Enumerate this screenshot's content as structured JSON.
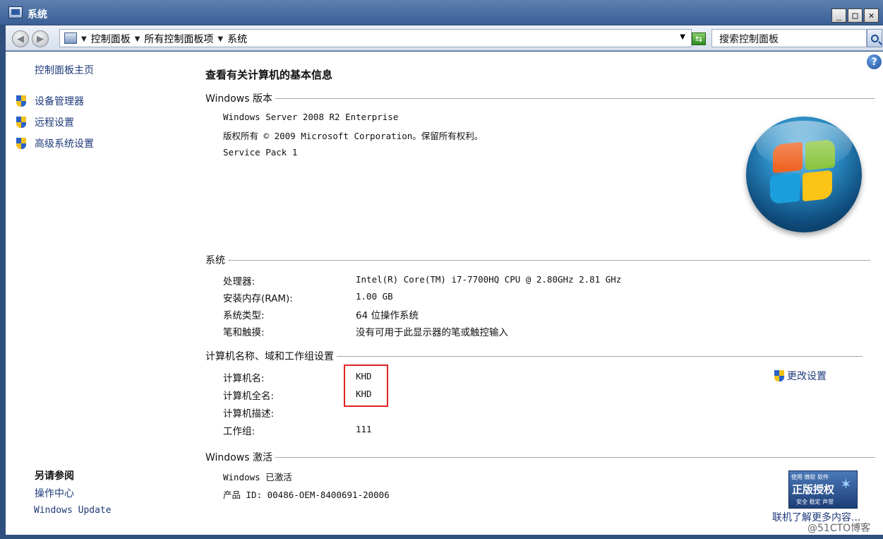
{
  "window": {
    "title": "系统",
    "minimize_glyph": "_",
    "maximize_glyph": "□",
    "close_glyph": "✕"
  },
  "address": {
    "breadcrumbs": [
      "控制面板",
      "所有控制面板项",
      "系统"
    ],
    "search_text": "搜索控制面板"
  },
  "sidebar": {
    "home_link": "控制面板主页",
    "tasks": [
      {
        "label": "设备管理器",
        "icon": "uac-shield-icon"
      },
      {
        "label": "远程设置",
        "icon": "uac-shield-icon"
      },
      {
        "label": "高级系统设置",
        "icon": "uac-shield-icon"
      }
    ],
    "see_also_title": "另请参阅",
    "see_also": [
      "操作中心",
      "Windows Update"
    ]
  },
  "main": {
    "page_title": "查看有关计算机的基本信息",
    "edition": {
      "heading": "Windows 版本",
      "name": "Windows Server 2008 R2 Enterprise",
      "copyright": "版权所有 © 2009 Microsoft Corporation。保留所有权利。",
      "service_pack": "Service Pack 1"
    },
    "system": {
      "heading": "系统",
      "rows": [
        {
          "label": "处理器:",
          "value": "Intel(R) Core(TM) i7-7700HQ CPU @ 2.80GHz   2.81 GHz"
        },
        {
          "label": "安装内存(RAM):",
          "value": "1.00 GB"
        },
        {
          "label": "系统类型:",
          "value": "64 位操作系统"
        },
        {
          "label": "笔和触摸:",
          "value": "没有可用于此显示器的笔或触控输入"
        }
      ]
    },
    "computer_name": {
      "heading": "计算机名称、域和工作组设置",
      "rows": [
        {
          "label": "计算机名:",
          "value": "KHD"
        },
        {
          "label": "计算机全名:",
          "value": "KHD"
        },
        {
          "label": "计算机描述:",
          "value": ""
        },
        {
          "label": "工作组:",
          "value": "111"
        }
      ],
      "change_settings": "更改设置",
      "highlight_color": "#e02222"
    },
    "activation": {
      "heading": "Windows 激活",
      "status": "Windows 已激活",
      "product_id": "产品 ID: 00486-OEM-8400691-20006",
      "genuine_badge": {
        "top": "使用 微软 软件",
        "main": "正版授权",
        "bottom": "安全 稳定 声誉"
      },
      "learn_more": "联机了解更多内容..."
    }
  },
  "watermark": "@51CTO博客",
  "colors": {
    "link": "#1e3a7a",
    "title_bar": "#3a5f95"
  }
}
